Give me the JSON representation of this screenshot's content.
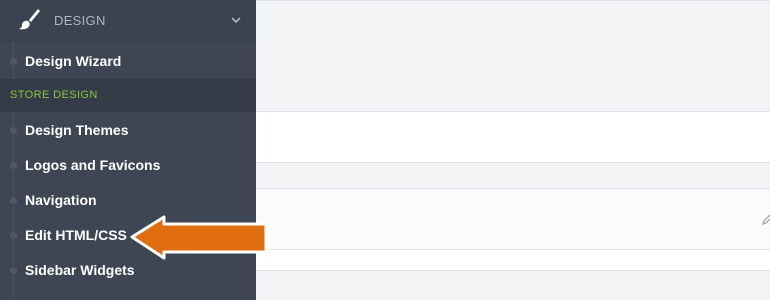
{
  "sidebar": {
    "section": {
      "title": "DESIGN",
      "icon": "paintbrush-icon",
      "expand_icon": "chevron-down-icon"
    },
    "items": [
      {
        "label": "Design Wizard"
      },
      {
        "label": "Design Themes"
      },
      {
        "label": "Logos and Favicons"
      },
      {
        "label": "Navigation"
      },
      {
        "label": "Edit HTML/CSS"
      },
      {
        "label": "Sidebar Widgets"
      }
    ],
    "group_label": "STORE DESIGN"
  },
  "main": {
    "edit_icon": "pencil-icon"
  },
  "annotation": {
    "pointer": "arrow-pointer-icon",
    "pointer_color": "#e06d10"
  },
  "colors": {
    "sidebar_bg": "#3d4652",
    "group_label_color": "#8cc63f",
    "content_bg": "#f2f4f6"
  }
}
